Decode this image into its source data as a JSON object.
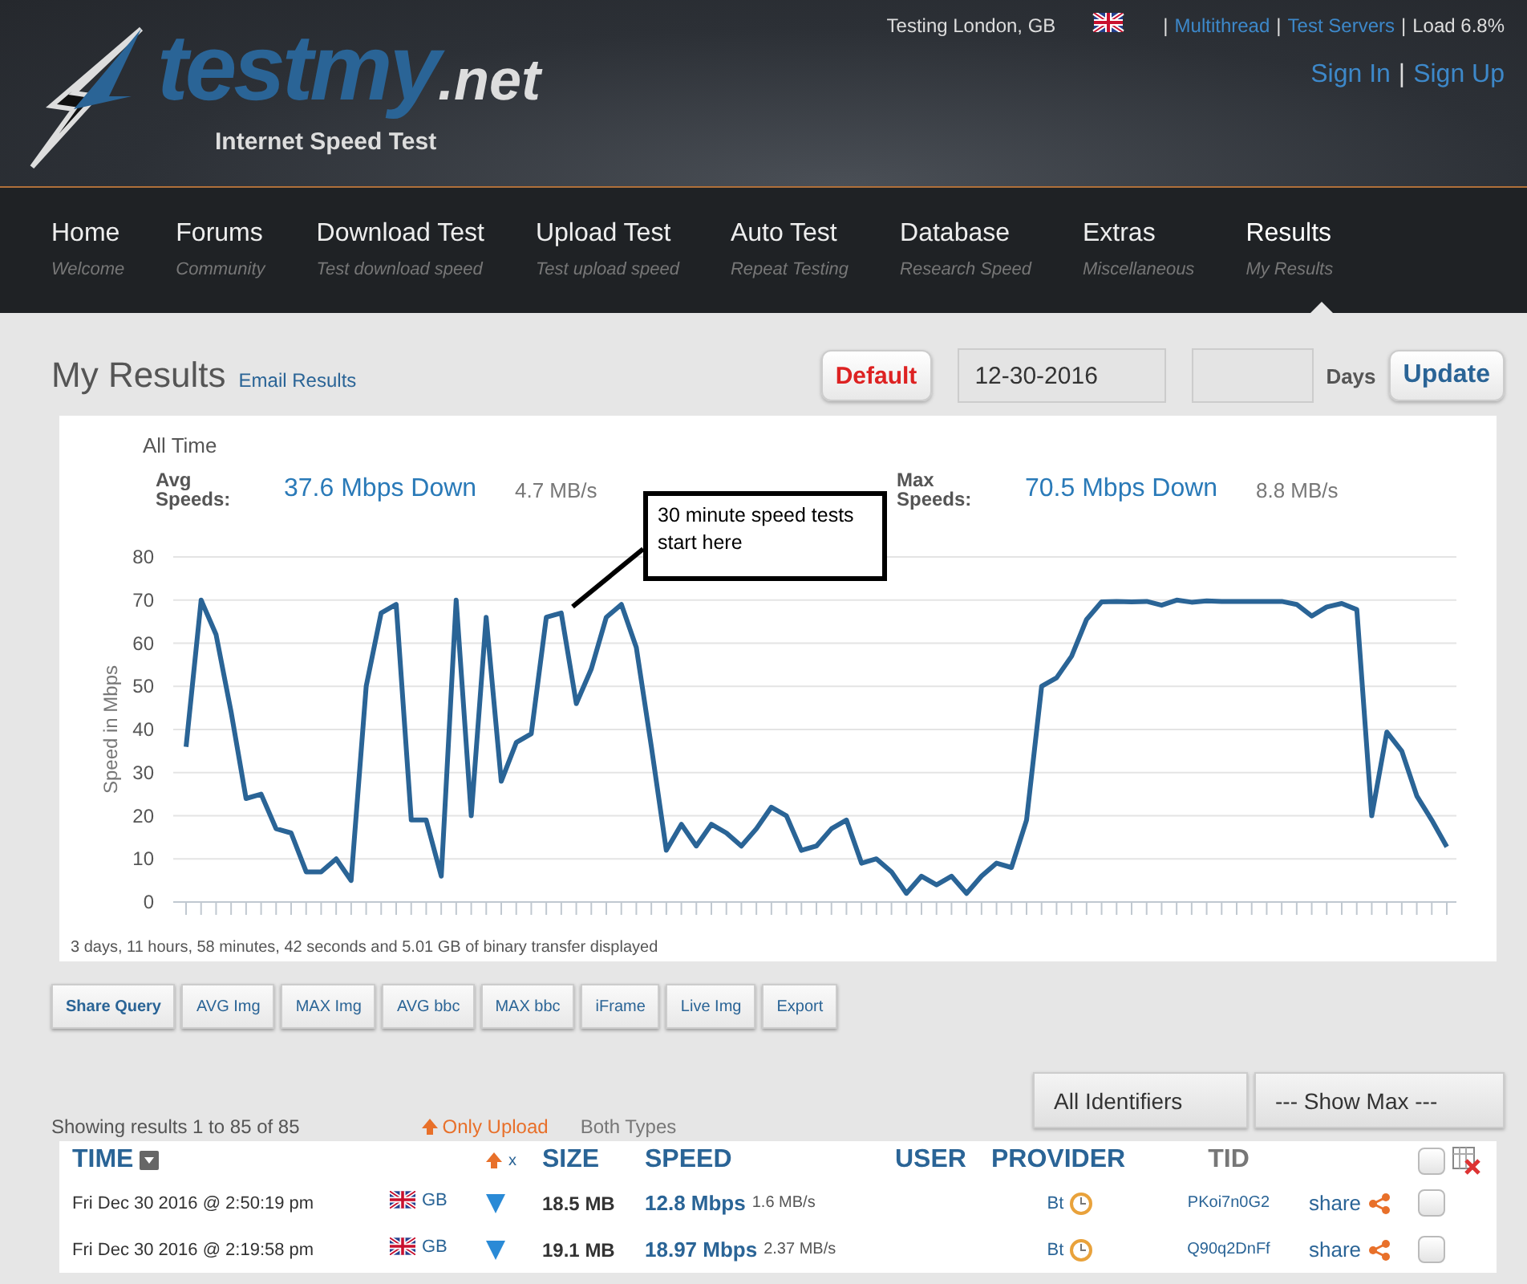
{
  "header": {
    "separator": "|",
    "location": "Testing London, GB",
    "links": [
      "Multithread",
      "Test Servers"
    ],
    "load": "Load 6.8%",
    "auth": [
      "Sign In",
      "Sign Up"
    ],
    "logo": {
      "main": "testmy",
      "suffix": ".net",
      "tagline": "Internet Speed Test"
    }
  },
  "nav": [
    {
      "label": "Home",
      "sub": "Welcome",
      "selected": false
    },
    {
      "label": "Forums",
      "sub": "Community",
      "selected": false
    },
    {
      "label": "Download Test",
      "sub": "Test download speed",
      "selected": false
    },
    {
      "label": "Upload Test",
      "sub": "Test upload speed",
      "selected": false
    },
    {
      "label": "Auto Test",
      "sub": "Repeat Testing",
      "selected": false
    },
    {
      "label": "Database",
      "sub": "Research Speed",
      "selected": false
    },
    {
      "label": "Extras",
      "sub": "Miscellaneous",
      "selected": false
    },
    {
      "label": "Results",
      "sub": "My Results",
      "selected": true
    }
  ],
  "page": {
    "title": "My Results",
    "email_link": "Email Results",
    "default_button": "Default",
    "date_value": "12-30-2016",
    "days_label": "Days",
    "update_button": "Update"
  },
  "summary": {
    "period": "All Time",
    "avg_label": "Avg Speeds:",
    "avg_speed": "37.6 Mbps Down",
    "avg_rate": "4.7 MB/s",
    "max_label": "Max Speeds:",
    "max_speed": "70.5 Mbps Down",
    "max_rate": "8.8 MB/s"
  },
  "chart_data": {
    "type": "line",
    "grid": true,
    "ylabel": "Speed in Mbps",
    "ylim": [
      0,
      80
    ],
    "yticks": [
      0,
      10,
      20,
      30,
      40,
      50,
      60,
      70,
      80
    ],
    "series": [
      {
        "color": "#2a6496",
        "values": [
          36,
          70,
          62,
          44,
          24,
          25,
          17,
          16,
          7,
          7,
          10,
          5,
          50,
          67,
          69,
          19,
          19,
          6,
          70,
          20,
          66,
          28,
          37,
          39,
          66,
          67,
          46,
          54,
          66,
          69,
          59,
          36,
          12,
          18,
          13,
          18,
          16,
          13,
          17,
          22,
          20,
          12,
          13,
          17,
          19,
          9,
          10,
          7,
          2,
          6,
          4,
          6,
          2,
          6,
          9,
          8,
          19,
          50,
          52,
          57,
          65.5,
          69.6,
          69.7,
          69.6,
          69.7,
          68.8,
          70,
          69.5,
          69.8,
          69.7,
          69.7,
          69.7,
          69.7,
          69.7,
          69,
          66.3,
          68.4,
          69.2,
          67.8,
          20,
          39.4,
          35,
          24.6,
          19,
          12.8
        ]
      }
    ],
    "annotations": [
      {
        "text": "30 minute speed tests start here"
      }
    ]
  },
  "chart_footer": "3 days, 11 hours, 58 minutes, 42 seconds and 5.01 GB of binary transfer displayed",
  "tool_buttons": [
    "Share Query",
    "AVG Img",
    "MAX Img",
    "AVG bbc",
    "MAX bbc",
    "iFrame",
    "Live Img",
    "Export"
  ],
  "results_info": "Showing results 1 to 85 of 85",
  "type_filters": [
    {
      "label": "Only Upload",
      "selected": false
    },
    {
      "label": "Both Types",
      "selected": true
    }
  ],
  "selects": [
    "All Identifiers",
    "--- Show Max ---"
  ],
  "table": {
    "columns": [
      "TIME",
      "x",
      "SIZE",
      "SPEED",
      "USER",
      "PROVIDER",
      "TID"
    ],
    "all_checked": false,
    "rows": [
      {
        "time": "Fri Dec 30 2016 @ 2:50:19 pm",
        "country": "GB",
        "size": "18.5 MB",
        "speed": "12.8 Mbps",
        "rate": "1.6 MB/s",
        "provider": "Bt",
        "tid": "PKoi7n0G2",
        "share": "share",
        "checked": false
      },
      {
        "time": "Fri Dec 30 2016 @ 2:19:58 pm",
        "country": "GB",
        "size": "19.1 MB",
        "speed": "18.97 Mbps",
        "rate": "2.37 MB/s",
        "provider": "Bt",
        "tid": "Q90q2DnFf",
        "share": "share",
        "checked": false
      }
    ]
  }
}
